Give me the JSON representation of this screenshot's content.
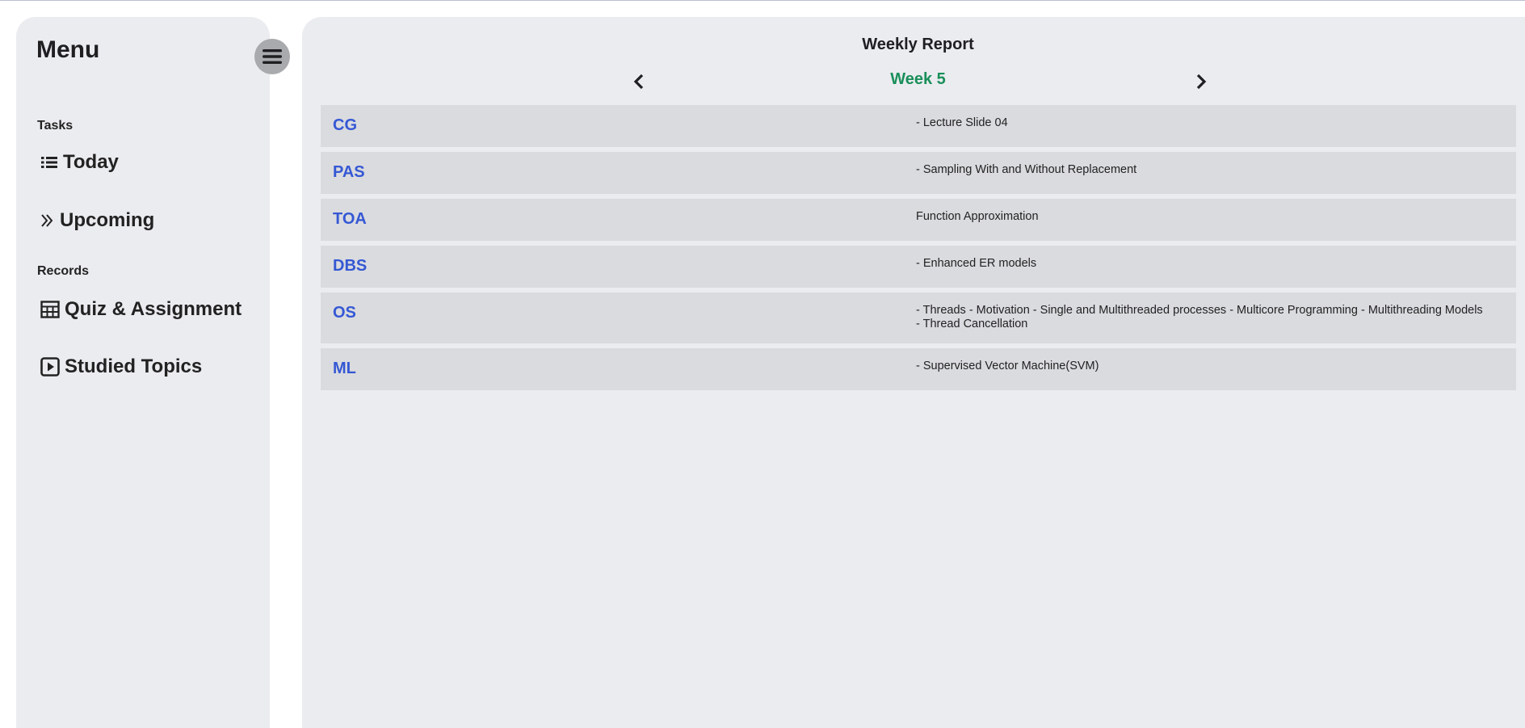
{
  "sidebar": {
    "title": "Menu",
    "sections": {
      "tasks": "Tasks",
      "records": "Records"
    },
    "items": [
      {
        "label": "Today",
        "icon": "list-icon"
      },
      {
        "label": "Upcoming",
        "icon": "double-chevron-right-icon"
      },
      {
        "label": "Quiz & Assignment",
        "icon": "table-icon"
      },
      {
        "label": "Studied Topics",
        "icon": "play-square-icon"
      }
    ]
  },
  "report": {
    "title": "Weekly Report",
    "week_label": "Week 5",
    "rows": [
      {
        "code": "CG",
        "topic": "- Lecture Slide 04"
      },
      {
        "code": "PAS",
        "topic": "- Sampling With and Without Replacement"
      },
      {
        "code": "TOA",
        "topic": "Function Approximation"
      },
      {
        "code": "DBS",
        "topic": "- Enhanced ER models"
      },
      {
        "code": "OS",
        "topic": "- Threads - Motivation - Single and Multithreaded processes - Multicore Programming - Multithreading Models - Thread Cancellation"
      },
      {
        "code": "ML",
        "topic": "- Supervised Vector Machine(SVM)"
      }
    ]
  },
  "colors": {
    "panel_bg": "#ebecf0",
    "row_bg": "#dadbdf",
    "course_code": "#3558d4",
    "week_label": "#1a8f5a",
    "toggle_bg": "#a9aaad"
  }
}
